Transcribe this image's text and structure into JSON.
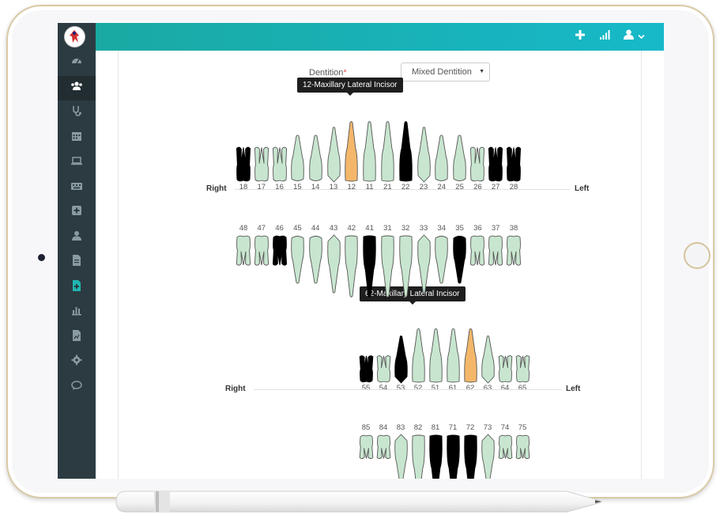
{
  "form": {
    "dentition_label": "Dentition",
    "required_mark": "*",
    "dentition_value": "Mixed Dentition"
  },
  "tooltips": {
    "permanent": "12-Maxillary Lateral Incisor",
    "primary": "62-Maxillary Lateral Incisor"
  },
  "labels": {
    "right": "Right",
    "left": "Left"
  },
  "colors": {
    "normal": "#c8e6cf",
    "selected": "#f4b76a",
    "missing": "#000000",
    "outline": "#555555",
    "topbar": "#17b0b4",
    "sidebar": "#2c3b41"
  },
  "topbar_icons": [
    "plus-icon",
    "signal-icon",
    "user-icon",
    "chevron-down-icon"
  ],
  "sidebar_icons": [
    "dashboard-icon",
    "users-icon",
    "stethoscope-icon",
    "calendar-icon",
    "laptop-icon",
    "keyboard-icon",
    "plus-square-icon",
    "user-md-icon",
    "file-icon",
    "file-medical-icon",
    "bar-chart-icon",
    "file-chart-icon",
    "gear-icon",
    "chat-icon"
  ],
  "permanent_upper": [
    {
      "num": "18",
      "state": "missing",
      "shape": "molar"
    },
    {
      "num": "17",
      "state": "normal",
      "shape": "molar"
    },
    {
      "num": "16",
      "state": "normal",
      "shape": "molar"
    },
    {
      "num": "15",
      "state": "normal",
      "shape": "premolar"
    },
    {
      "num": "14",
      "state": "normal",
      "shape": "premolar"
    },
    {
      "num": "13",
      "state": "normal",
      "shape": "canine"
    },
    {
      "num": "12",
      "state": "selected",
      "shape": "incisor"
    },
    {
      "num": "11",
      "state": "normal",
      "shape": "incisor"
    },
    {
      "num": "21",
      "state": "normal",
      "shape": "incisor"
    },
    {
      "num": "22",
      "state": "missing",
      "shape": "incisor"
    },
    {
      "num": "23",
      "state": "normal",
      "shape": "canine"
    },
    {
      "num": "24",
      "state": "normal",
      "shape": "premolar"
    },
    {
      "num": "25",
      "state": "normal",
      "shape": "premolar"
    },
    {
      "num": "26",
      "state": "normal",
      "shape": "molar"
    },
    {
      "num": "27",
      "state": "missing",
      "shape": "molar"
    },
    {
      "num": "28",
      "state": "missing",
      "shape": "molar"
    }
  ],
  "permanent_lower": [
    {
      "num": "48",
      "state": "normal",
      "shape": "molar"
    },
    {
      "num": "47",
      "state": "normal",
      "shape": "molar"
    },
    {
      "num": "46",
      "state": "missing",
      "shape": "molar"
    },
    {
      "num": "45",
      "state": "normal",
      "shape": "premolar"
    },
    {
      "num": "44",
      "state": "normal",
      "shape": "premolar"
    },
    {
      "num": "43",
      "state": "normal",
      "shape": "canine"
    },
    {
      "num": "42",
      "state": "normal",
      "shape": "incisor"
    },
    {
      "num": "41",
      "state": "missing",
      "shape": "incisor"
    },
    {
      "num": "31",
      "state": "normal",
      "shape": "incisor"
    },
    {
      "num": "32",
      "state": "normal",
      "shape": "incisor"
    },
    {
      "num": "33",
      "state": "normal",
      "shape": "canine"
    },
    {
      "num": "34",
      "state": "normal",
      "shape": "premolar"
    },
    {
      "num": "35",
      "state": "missing",
      "shape": "premolar"
    },
    {
      "num": "36",
      "state": "normal",
      "shape": "molar"
    },
    {
      "num": "37",
      "state": "normal",
      "shape": "molar"
    },
    {
      "num": "38",
      "state": "normal",
      "shape": "molar"
    }
  ],
  "primary_upper": [
    {
      "num": "55",
      "state": "missing",
      "shape": "molar"
    },
    {
      "num": "54",
      "state": "normal",
      "shape": "molar"
    },
    {
      "num": "53",
      "state": "missing",
      "shape": "canine"
    },
    {
      "num": "52",
      "state": "normal",
      "shape": "incisor"
    },
    {
      "num": "51",
      "state": "normal",
      "shape": "incisor"
    },
    {
      "num": "61",
      "state": "normal",
      "shape": "incisor"
    },
    {
      "num": "62",
      "state": "selected",
      "shape": "incisor"
    },
    {
      "num": "63",
      "state": "normal",
      "shape": "canine"
    },
    {
      "num": "64",
      "state": "normal",
      "shape": "molar"
    },
    {
      "num": "65",
      "state": "normal",
      "shape": "molar"
    }
  ],
  "primary_lower": [
    {
      "num": "85",
      "state": "normal",
      "shape": "molar"
    },
    {
      "num": "84",
      "state": "normal",
      "shape": "molar"
    },
    {
      "num": "83",
      "state": "normal",
      "shape": "canine"
    },
    {
      "num": "82",
      "state": "normal",
      "shape": "incisor"
    },
    {
      "num": "81",
      "state": "missing",
      "shape": "incisor"
    },
    {
      "num": "71",
      "state": "missing",
      "shape": "incisor"
    },
    {
      "num": "72",
      "state": "missing",
      "shape": "incisor"
    },
    {
      "num": "73",
      "state": "normal",
      "shape": "canine"
    },
    {
      "num": "74",
      "state": "normal",
      "shape": "molar"
    },
    {
      "num": "75",
      "state": "normal",
      "shape": "molar"
    }
  ]
}
